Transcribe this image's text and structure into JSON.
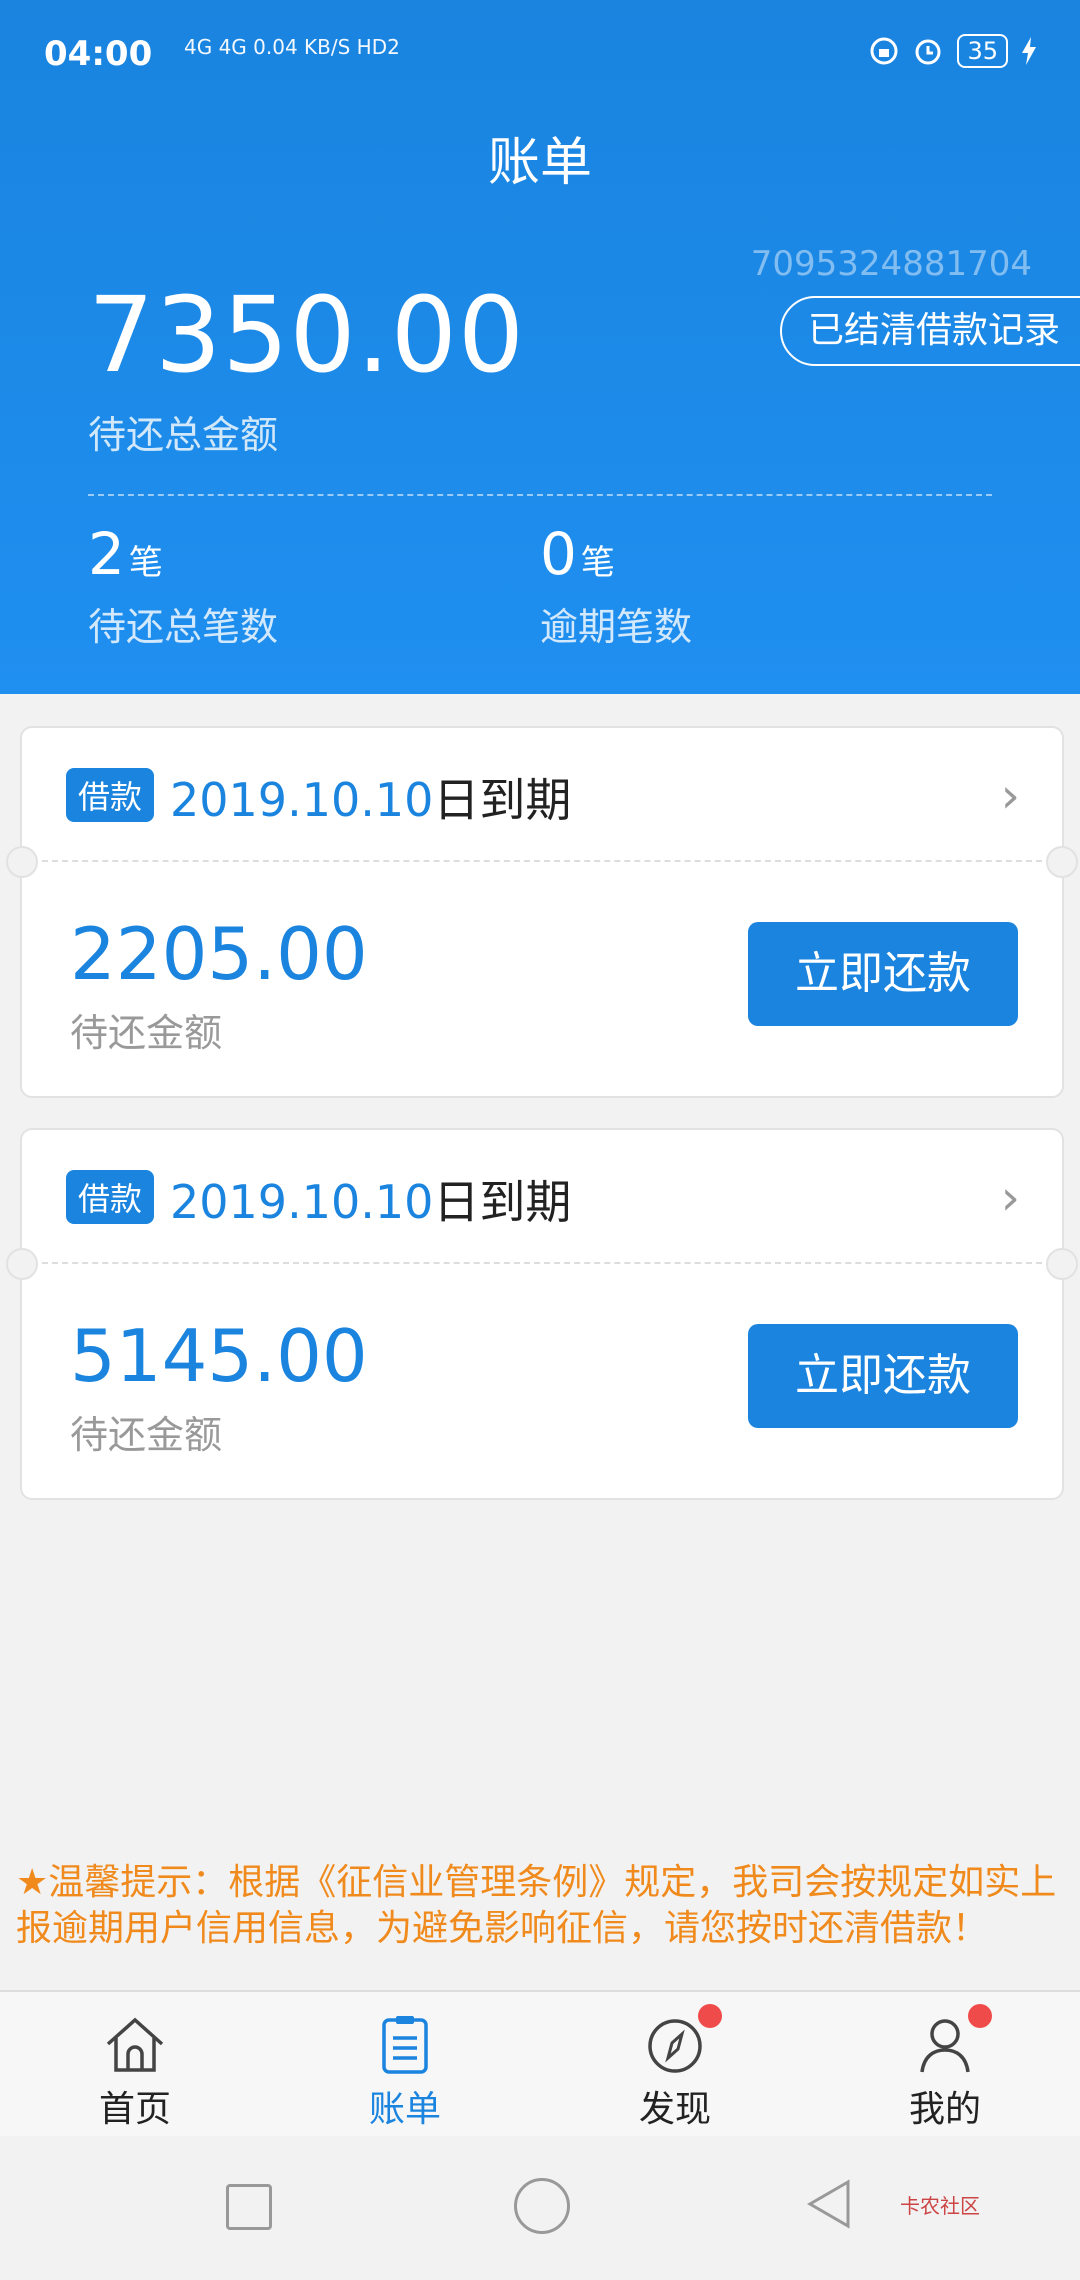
{
  "status_bar": {
    "time": "04:00",
    "network_info": "4G 4G 0.04 KB/S HD2",
    "battery": "35"
  },
  "header": {
    "title": "账单",
    "account_number": "7095324881704",
    "settled_button": "已结清借款记录",
    "total_amount": "7350.00",
    "total_label": "待还总金额",
    "pending_count": "2",
    "pending_unit": "笔",
    "pending_label": "待还总笔数",
    "overdue_count": "0",
    "overdue_unit": "笔",
    "overdue_label": "逾期笔数"
  },
  "bills": [
    {
      "tag": "借款",
      "date": "2019.10.10",
      "date_suffix": "日到期",
      "amount": "2205.00",
      "amount_label": "待还金额",
      "pay_button": "立即还款"
    },
    {
      "tag": "借款",
      "date": "2019.10.10",
      "date_suffix": "日到期",
      "amount": "5145.00",
      "amount_label": "待还金额",
      "pay_button": "立即还款"
    }
  ],
  "notice": "★温馨提示：根据《征信业管理条例》规定，我司会按规定如实上报逾期用户信用信息，为避免影响征信，请您按时还清借款！",
  "tabs": [
    {
      "label": "首页",
      "icon": "home-icon"
    },
    {
      "label": "账单",
      "icon": "bill-icon"
    },
    {
      "label": "发现",
      "icon": "compass-icon"
    },
    {
      "label": "我的",
      "icon": "user-icon"
    }
  ],
  "watermark": "卡农社区",
  "colors": {
    "primary": "#1a84df",
    "notice": "#f08a1c",
    "badge": "#f04b4b"
  }
}
